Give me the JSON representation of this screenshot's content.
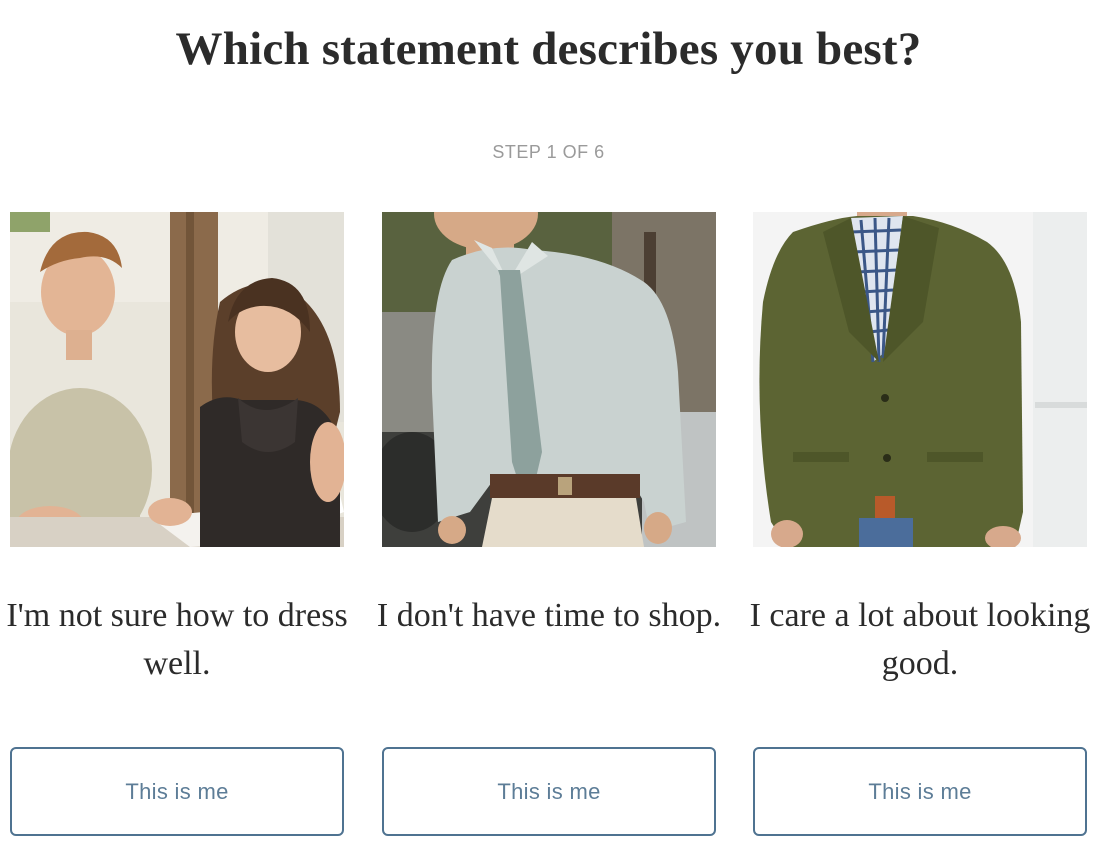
{
  "quiz": {
    "question": "Which statement describes you best?",
    "step_label": "STEP 1 OF 6"
  },
  "options": [
    {
      "photo": "couple-reviewing-papers-photo",
      "statement": "I'm not sure how to dress well.",
      "button_label": "This is me"
    },
    {
      "photo": "man-in-shirt-and-tie-photo",
      "statement": "I don't have time to shop.",
      "button_label": "This is me"
    },
    {
      "photo": "man-in-olive-blazer-photo",
      "statement": "I care a lot about looking good.",
      "button_label": "This is me"
    }
  ],
  "colors": {
    "accent": "#4f7391",
    "button_text": "#5d7d97",
    "heading": "#2b2b2b",
    "muted": "#9a9a9a"
  }
}
